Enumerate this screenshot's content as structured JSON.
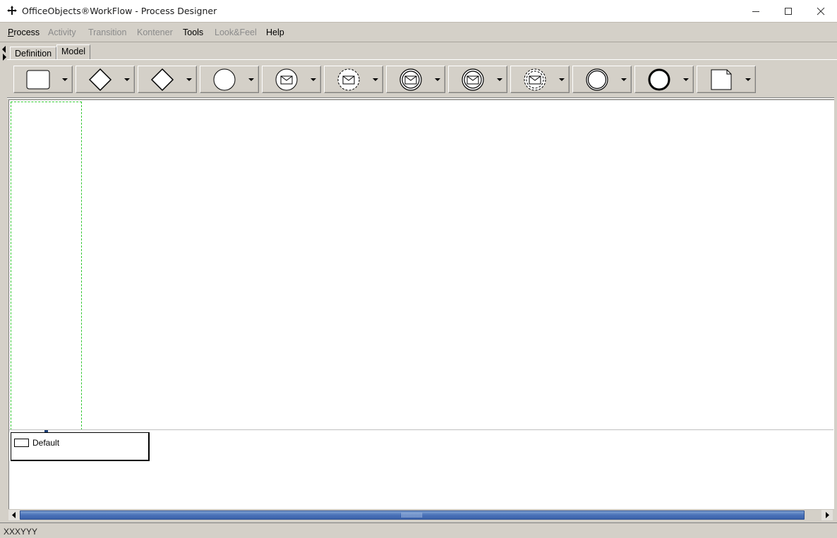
{
  "window": {
    "title": "OfficeObjects®WorkFlow - Process Designer",
    "controls": [
      "minimize",
      "maximize",
      "close"
    ]
  },
  "menu": [
    {
      "label": "Process",
      "enabled": true
    },
    {
      "label": "Activity",
      "enabled": false
    },
    {
      "label": "Transition",
      "enabled": false
    },
    {
      "label": "Kontener",
      "enabled": false
    },
    {
      "label": "Tools",
      "enabled": true
    },
    {
      "label": "Look&Feel",
      "enabled": false
    },
    {
      "label": "Help",
      "enabled": true
    }
  ],
  "tabs": [
    {
      "label": "Definition",
      "active": false
    },
    {
      "label": "Model",
      "active": true
    }
  ],
  "toolbar": {
    "tools": [
      {
        "name": "task-tool",
        "icon": "rounded-rectangle-icon"
      },
      {
        "name": "gateway-tool",
        "icon": "diamond-icon"
      },
      {
        "name": "gateway-alt-tool",
        "icon": "diamond-icon"
      },
      {
        "name": "start-event-tool",
        "icon": "circle-icon"
      },
      {
        "name": "message-start-event-tool",
        "icon": "message-circle-icon"
      },
      {
        "name": "message-dashed-event-tool",
        "icon": "dashed-message-circle-icon"
      },
      {
        "name": "intermediate-message-event-tool",
        "icon": "double-message-circle-icon"
      },
      {
        "name": "intermediate-message-throw-tool",
        "icon": "double-message-circle-filled-icon"
      },
      {
        "name": "non-interrupting-message-tool",
        "icon": "dashed-double-message-circle-icon"
      },
      {
        "name": "intermediate-event-tool",
        "icon": "double-circle-icon"
      },
      {
        "name": "end-event-tool",
        "icon": "thick-circle-icon"
      },
      {
        "name": "document-tool",
        "icon": "document-icon"
      }
    ]
  },
  "canvas": {
    "legend": {
      "label": "Default"
    }
  },
  "status": {
    "text": "XXXYYY"
  },
  "colors": {
    "chrome": "#d4d0c8",
    "lane_border": "#32c832",
    "scrollbar": "#4a72b8"
  }
}
